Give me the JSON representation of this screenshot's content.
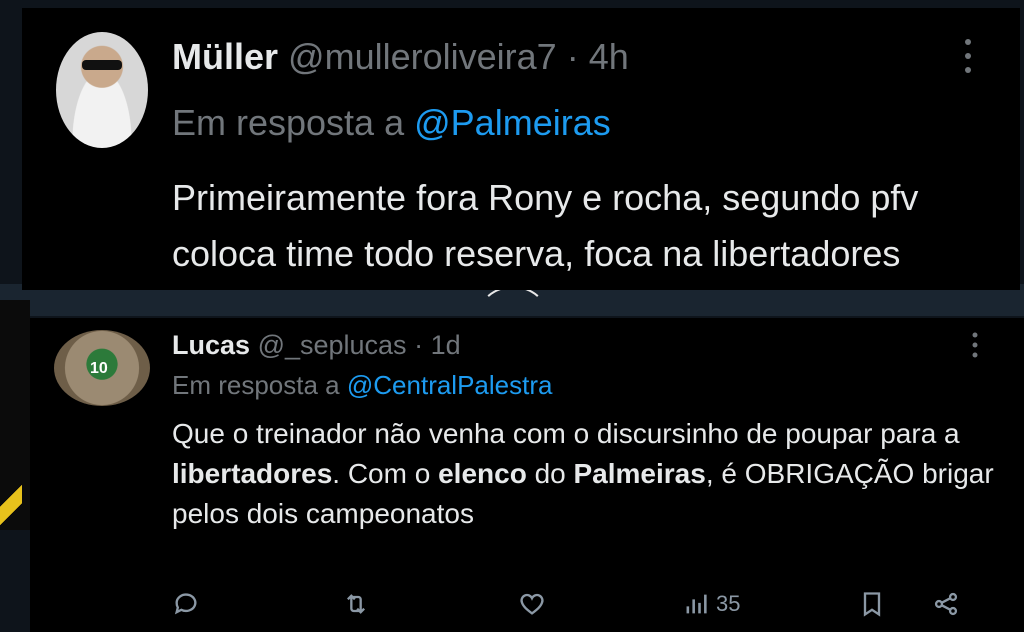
{
  "tweet1": {
    "name": "Müller",
    "handle": "@mulleroliveira7",
    "separator": "·",
    "time": "4h",
    "reply_prefix": "Em resposta a",
    "reply_to": "@Palmeiras",
    "body": "Primeiramente fora Rony e rocha, segundo pfv coloca time todo reserva, foca na libertadores"
  },
  "tweet2": {
    "name": "Lucas",
    "handle": "@_seplucas",
    "separator": "·",
    "time": "1d",
    "reply_prefix": "Em resposta a",
    "reply_to": "@CentralPalestra",
    "avatar_number": "10",
    "body_parts": {
      "p1": "Que o treinador não venha com o discursinho de poupar para a ",
      "b1": "libertadores",
      "p2": ". Com o ",
      "b2": "elenco",
      "p3": " do ",
      "b3": "Palmeiras",
      "p4": ", é OBRIGAÇÃO brigar pelos dois campeonatos"
    },
    "views_count": "35"
  },
  "colors": {
    "background": "#000000",
    "text": "#e7e9ea",
    "muted": "#71767b",
    "mention": "#1d9bf0"
  }
}
